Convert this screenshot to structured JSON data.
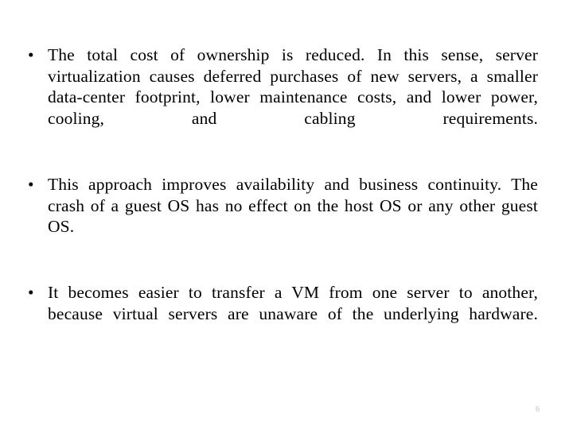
{
  "slide": {
    "background_color": "#ffffff",
    "text_color": "#000000",
    "bullet_glyph": "•",
    "bullets": [
      {
        "id": "tco-reduced",
        "text": "The total cost of ownership is reduced. In this sense, server virtualization causes deferred purchases of new servers, a smaller data-center footprint, lower maintenance costs, and lower power, cooling, and cabling requirements."
      },
      {
        "id": "availability-continuity",
        "text": "This approach improves availability and business continuity. The crash of a guest OS has no effect on the host OS or any other guest OS."
      },
      {
        "id": "vm-transfer",
        "text": "It becomes easier to transfer a VM from one server to another, because virtual servers are unaware of the underlying hardware."
      }
    ],
    "page_number": "6",
    "page_number_color": "#bdbdbd"
  }
}
